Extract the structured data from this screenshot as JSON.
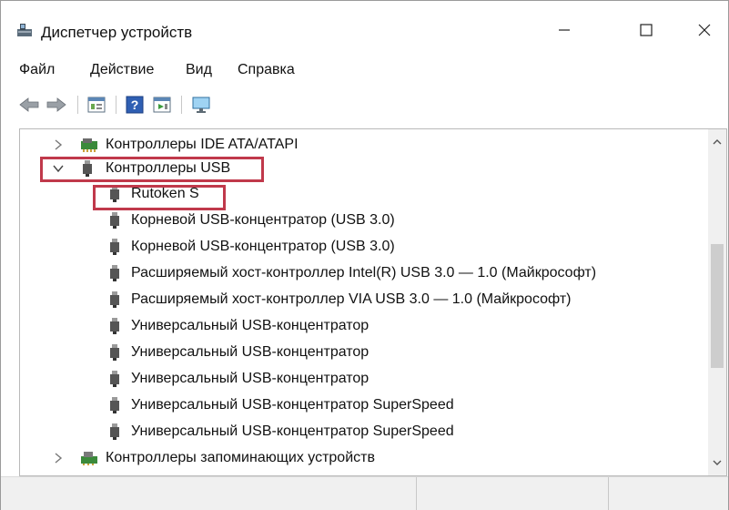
{
  "window": {
    "title": "Диспетчер устройств",
    "icon": "device-manager-icon"
  },
  "menu": [
    {
      "label": "Файл"
    },
    {
      "label": "Действие"
    },
    {
      "label": "Вид"
    },
    {
      "label": "Справка"
    }
  ],
  "toolbar": {
    "buttons": [
      "back-arrow-icon",
      "forward-arrow-icon",
      "properties-icon",
      "help-icon",
      "update-driver-icon",
      "monitor-icon"
    ]
  },
  "tree": {
    "items": [
      {
        "label": "Контроллеры IDE ATA/ATAPI",
        "expanded": false,
        "icon": "ide-controller-icon"
      },
      {
        "label": "Контроллеры USB",
        "expanded": true,
        "icon": "usb-plug-icon",
        "highlighted": true
      },
      {
        "label": "Rutoken S",
        "icon": "usb-plug-icon",
        "highlighted": true
      },
      {
        "label": "Корневой USB-концентратор (USB 3.0)",
        "icon": "usb-plug-icon"
      },
      {
        "label": "Корневой USB-концентратор (USB 3.0)",
        "icon": "usb-plug-icon"
      },
      {
        "label": "Расширяемый хост-контроллер Intel(R) USB 3.0 — 1.0 (Майкрософт)",
        "icon": "usb-plug-icon"
      },
      {
        "label": "Расширяемый хост-контроллер VIA USB 3.0 — 1.0 (Майкрософт)",
        "icon": "usb-plug-icon"
      },
      {
        "label": "Универсальный USB-концентратор",
        "icon": "usb-plug-icon"
      },
      {
        "label": "Универсальный USB-концентратор",
        "icon": "usb-plug-icon"
      },
      {
        "label": "Универсальный USB-концентратор",
        "icon": "usb-plug-icon"
      },
      {
        "label": "Универсальный USB-концентратор SuperSpeed",
        "icon": "usb-plug-icon"
      },
      {
        "label": "Универсальный USB-концентратор SuperSpeed",
        "icon": "usb-plug-icon"
      },
      {
        "label": "Контроллеры запоминающих устройств",
        "expanded": false,
        "icon": "storage-controller-icon"
      }
    ]
  },
  "colors": {
    "highlight": "#c0394b",
    "statusbar": "#f0f0f0"
  }
}
